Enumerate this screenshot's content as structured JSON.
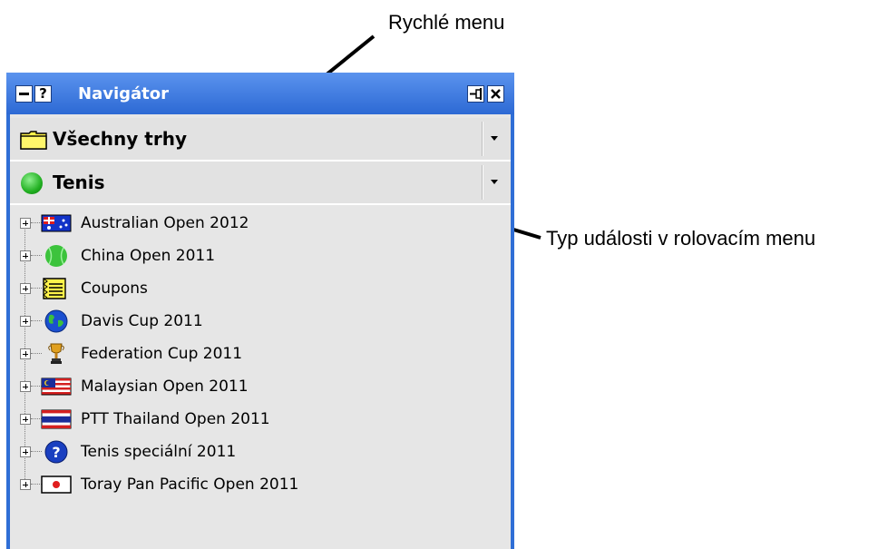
{
  "annotations": {
    "quick_menu": "Rychlé menu",
    "event_type": "Typ události v rolovacím menu"
  },
  "window": {
    "title": "Navigátor",
    "help_glyph": "?",
    "close_glyph": "✕",
    "pin_glyph": "⊣"
  },
  "market_dropdown": {
    "label": "Všechny trhy",
    "icon": "folder-icon"
  },
  "sport_dropdown": {
    "label": "Tenis",
    "icon": "tennis-ball-icon"
  },
  "tree": {
    "items": [
      {
        "label": "Australian Open 2012",
        "icon": "australia-flag-icon"
      },
      {
        "label": "China Open 2011",
        "icon": "tennis-ball-icon"
      },
      {
        "label": "Coupons",
        "icon": "coupon-icon"
      },
      {
        "label": "Davis Cup 2011",
        "icon": "globe-icon"
      },
      {
        "label": "Federation Cup 2011",
        "icon": "trophy-icon"
      },
      {
        "label": "Malaysian Open 2011",
        "icon": "malaysia-flag-icon"
      },
      {
        "label": "PTT Thailand Open 2011",
        "icon": "thailand-flag-icon"
      },
      {
        "label": "Tenis speciální 2011",
        "icon": "question-icon"
      },
      {
        "label": "Toray Pan Pacific Open 2011",
        "icon": "japan-flag-icon"
      }
    ]
  },
  "colors": {
    "titlebar": "#2d69d4",
    "panel_bg": "#e6e6e6",
    "accent_green": "#22b022"
  }
}
